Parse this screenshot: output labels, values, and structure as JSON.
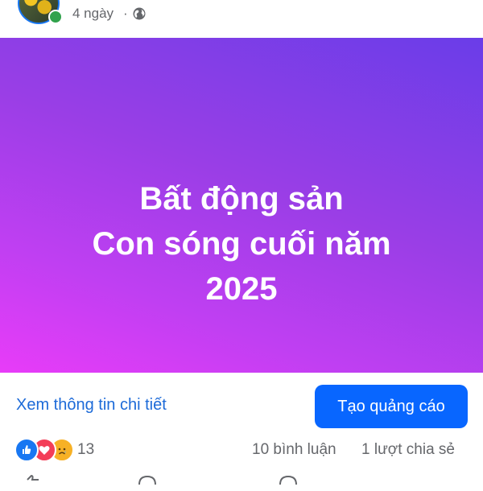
{
  "post": {
    "time": "4 ngày",
    "separator": "·",
    "privacy_icon": "globe-icon"
  },
  "banner": {
    "line1": "Bất động sản",
    "line2": "Con sóng cuối năm",
    "line3": "2025",
    "gradient_colors": [
      "#6a3de8",
      "#9a3ee6",
      "#c03ff2",
      "#e83cf8"
    ]
  },
  "cta": {
    "details_label": "Xem thông tin chi tiết",
    "ad_button_label": "Tạo quảng cáo",
    "accent_color": "#0866ff"
  },
  "stats": {
    "reaction_icons": [
      "like-icon",
      "love-icon",
      "sad-icon"
    ],
    "reaction_count": "13",
    "comments": "10 bình luận",
    "shares": "1 lượt chia sẻ"
  },
  "actions": {
    "icons": [
      "like-icon",
      "comment-icon",
      "share-icon"
    ]
  }
}
